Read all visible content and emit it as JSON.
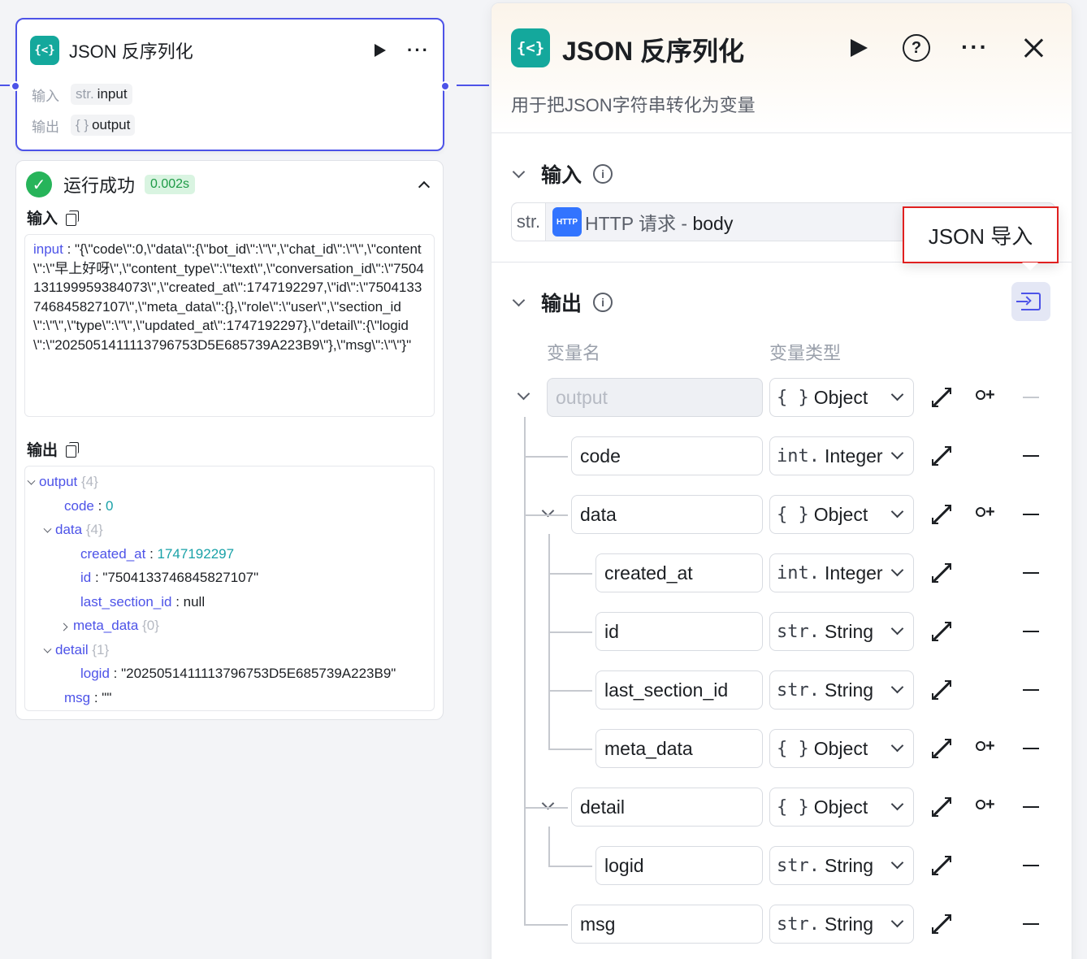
{
  "node": {
    "title": "JSON 反序列化",
    "input_label": "输入",
    "input_type": "str.",
    "input_name": "input",
    "output_label": "输出",
    "output_type": "{ }",
    "output_name": "output",
    "run_icon": "play-icon",
    "more_icon": "more-icon"
  },
  "result": {
    "status": "运行成功",
    "duration": "0.002s",
    "input_title": "输入",
    "input_key": "input",
    "input_value": "\"{\\\"code\\\":0,\\\"data\\\":{\\\"bot_id\\\":\\\"\\\",\\\"chat_id\\\":\\\"\\\",\\\"content\\\":\\\"早上好呀\\\",\\\"content_type\\\":\\\"text\\\",\\\"conversation_id\\\":\\\"7504131199959384073\\\",\\\"created_at\\\":1747192297,\\\"id\\\":\\\"7504133746845827107\\\",\\\"meta_data\\\":{},\\\"role\\\":\\\"user\\\",\\\"section_id\\\":\\\"\\\",\\\"type\\\":\\\"\\\",\\\"updated_at\\\":1747192297},\\\"detail\\\":{\\\"logid\\\":\\\"2025051411113796753D5E685739A223B9\\\"},\\\"msg\\\":\\\"\\\"}\"",
    "output_title": "输出",
    "tree": [
      {
        "key": "output",
        "count": "{4}",
        "value": "",
        "kind": "obj",
        "depth": 0
      },
      {
        "key": "code",
        "count": "",
        "value": "0",
        "kind": "num",
        "depth": 1
      },
      {
        "key": "data",
        "count": "{4}",
        "value": "",
        "kind": "obj",
        "depth": 1
      },
      {
        "key": "created_at",
        "count": "",
        "value": "1747192297",
        "kind": "num",
        "depth": 2
      },
      {
        "key": "id",
        "count": "",
        "value": "\"7504133746845827107\"",
        "kind": "str",
        "depth": 2
      },
      {
        "key": "last_section_id",
        "count": "",
        "value": "null",
        "kind": "str",
        "depth": 2
      },
      {
        "key": "meta_data",
        "count": "{0}",
        "value": "",
        "kind": "objc",
        "depth": 2
      },
      {
        "key": "detail",
        "count": "{1}",
        "value": "",
        "kind": "obj",
        "depth": 1
      },
      {
        "key": "logid",
        "count": "",
        "value": "\"2025051411113796753D5E685739A223B9\"",
        "kind": "str",
        "depth": 2
      },
      {
        "key": "msg",
        "count": "",
        "value": "\"\"",
        "kind": "str",
        "depth": 1
      }
    ]
  },
  "panel": {
    "title": "JSON 反序列化",
    "description": "用于把JSON字符串转化为变量",
    "input_section": "输入",
    "input_prefix": "str.",
    "input_ref_source": "HTTP 请求 - ",
    "input_ref_field": "body",
    "output_section": "输出",
    "col_name": "变量名",
    "col_type": "变量类型",
    "tooltip": "JSON 导入",
    "fields": [
      {
        "name": "output",
        "type_icon": "{ }",
        "type": "Object",
        "depth": 0,
        "disabled": true,
        "expandable": true,
        "can_add_child": true
      },
      {
        "name": "code",
        "type_icon": "int.",
        "type": "Integer",
        "depth": 1,
        "disabled": false,
        "expandable": false,
        "can_add_child": false
      },
      {
        "name": "data",
        "type_icon": "{ }",
        "type": "Object",
        "depth": 1,
        "disabled": false,
        "expandable": true,
        "can_add_child": true
      },
      {
        "name": "created_at",
        "type_icon": "int.",
        "type": "Integer",
        "depth": 2,
        "disabled": false,
        "expandable": false,
        "can_add_child": false
      },
      {
        "name": "id",
        "type_icon": "str.",
        "type": "String",
        "depth": 2,
        "disabled": false,
        "expandable": false,
        "can_add_child": false
      },
      {
        "name": "last_section_id",
        "type_icon": "str.",
        "type": "String",
        "depth": 2,
        "disabled": false,
        "expandable": false,
        "can_add_child": false
      },
      {
        "name": "meta_data",
        "type_icon": "{ }",
        "type": "Object",
        "depth": 2,
        "disabled": false,
        "expandable": false,
        "can_add_child": true
      },
      {
        "name": "detail",
        "type_icon": "{ }",
        "type": "Object",
        "depth": 1,
        "disabled": false,
        "expandable": true,
        "can_add_child": true
      },
      {
        "name": "logid",
        "type_icon": "str.",
        "type": "String",
        "depth": 2,
        "disabled": false,
        "expandable": false,
        "can_add_child": false
      },
      {
        "name": "msg",
        "type_icon": "str.",
        "type": "String",
        "depth": 1,
        "disabled": false,
        "expandable": false,
        "can_add_child": false
      }
    ]
  },
  "colors": {
    "accent": "#4d53e8",
    "success": "#27b45a",
    "node_logo": "#14a89c",
    "highlight_box": "#e02020"
  }
}
